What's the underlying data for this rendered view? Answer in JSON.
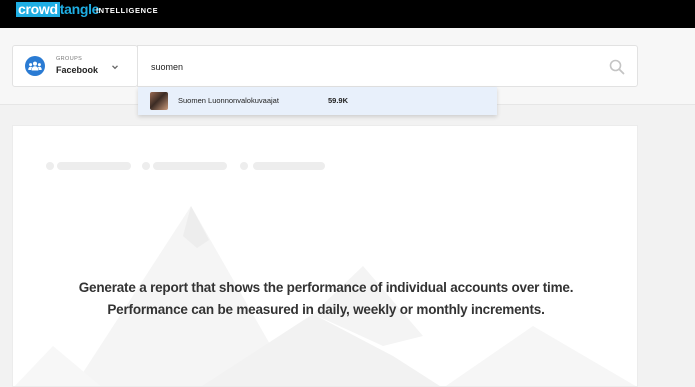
{
  "header": {
    "logo_part1": "crowd",
    "logo_part2": "tangle",
    "nav_item": "INTELLIGENCE"
  },
  "group_selector": {
    "type_label": "GROUPS",
    "platform": "Facebook",
    "icon": "group-people-icon",
    "chevron": "chevron-down-icon"
  },
  "search": {
    "value": "suomen",
    "icon": "search-icon"
  },
  "suggestions": [
    {
      "name": "Suomen Luonnonvalokuvaajat",
      "count": "59.9K"
    }
  ],
  "empty_state": {
    "line1": "Generate a report that shows the performance of individual accounts over time.",
    "line2": "Performance can be measured in daily, weekly or monthly increments."
  },
  "colors": {
    "brand": "#1faee3",
    "avatar": "#2a7bd3",
    "highlight": "#e8f0fb"
  }
}
